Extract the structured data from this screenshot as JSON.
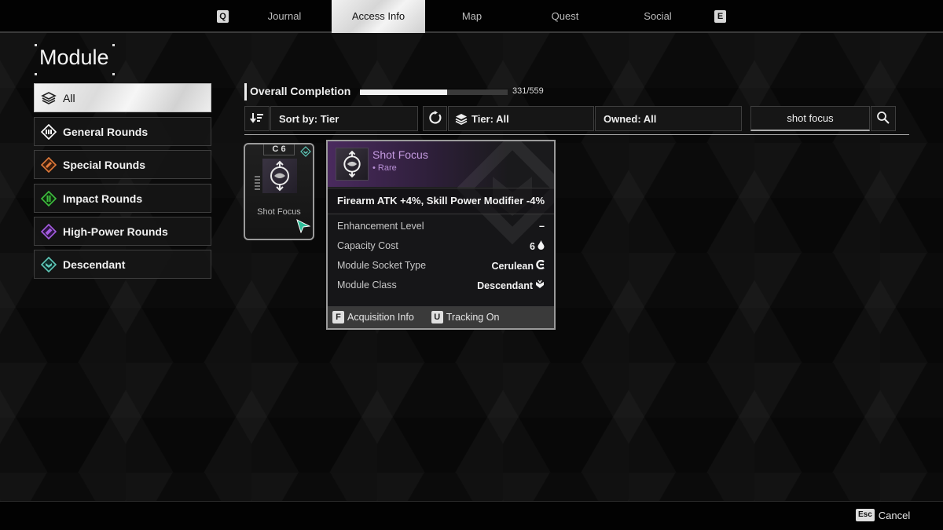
{
  "nav": {
    "left_key": "Q",
    "right_key": "E",
    "tabs": [
      {
        "label": "Journal",
        "active": false
      },
      {
        "label": "Access Info",
        "active": true
      },
      {
        "label": "Map",
        "active": false
      },
      {
        "label": "Quest",
        "active": false
      },
      {
        "label": "Social",
        "active": false
      }
    ]
  },
  "page_title": "Module",
  "categories": [
    {
      "label": "All",
      "icon": "layers-icon",
      "active": true
    },
    {
      "label": "General Rounds",
      "icon": "general-rounds-icon",
      "color": "#ffffff"
    },
    {
      "label": "Special Rounds",
      "icon": "special-rounds-icon",
      "color": "#e07a3a"
    },
    {
      "label": "Impact Rounds",
      "icon": "impact-rounds-icon",
      "color": "#3fbf3f"
    },
    {
      "label": "High-Power Rounds",
      "icon": "high-power-rounds-icon",
      "color": "#a45ce0"
    },
    {
      "label": "Descendant",
      "icon": "descendant-icon",
      "color": "#5fc8b8"
    }
  ],
  "completion": {
    "label": "Overall Completion",
    "current": 331,
    "total": 559,
    "text": "331/559"
  },
  "filters": {
    "sort_label": "Sort by: Tier",
    "tier_label": "Tier: All",
    "owned_label": "Owned: All",
    "search_value": "shot focus",
    "search_placeholder": ""
  },
  "module_card": {
    "name": "Shot Focus",
    "capacity": "6",
    "socket_symbol": "C"
  },
  "detail": {
    "name": "Shot Focus",
    "rarity": "• Rare",
    "rarity_color": "#c59be0",
    "effect": "Firearm ATK +4%, Skill Power Modifier -4%",
    "stats": [
      {
        "label": "Enhancement Level",
        "value": "–"
      },
      {
        "label": "Capacity Cost",
        "value": "6"
      },
      {
        "label": "Module Socket Type",
        "value": "Cerulean"
      },
      {
        "label": "Module Class",
        "value": "Descendant"
      }
    ],
    "footer": [
      {
        "key": "F",
        "label": "Acquisition Info"
      },
      {
        "key": "U",
        "label": "Tracking On"
      }
    ]
  },
  "cancel": {
    "key": "Esc",
    "label": "Cancel"
  }
}
